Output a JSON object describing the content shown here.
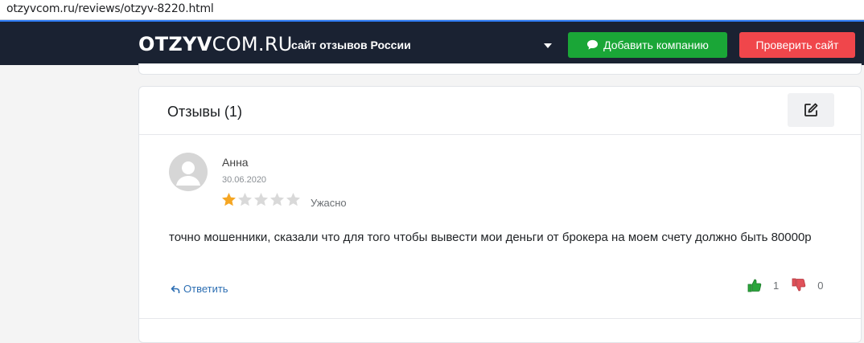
{
  "browser": {
    "url": "otzyvcom.ru/reviews/otzyv-8220.html"
  },
  "header": {
    "logo_bold": "OTZYV",
    "logo_light": "COM.RU",
    "tagline": "сайт отзывов России",
    "add_company_label": "Добавить компанию",
    "check_site_label": "Проверить сайт",
    "colors": {
      "background": "#1a2232",
      "add_button": "#1aa637",
      "check_button": "#f0464b"
    }
  },
  "reviews": {
    "title": "Отзывы (1)",
    "items": [
      {
        "author": "Анна",
        "date": "30.06.2020",
        "rating": 1,
        "rating_max": 5,
        "rating_label": "Ужасно",
        "text": "точно мошенники, сказали что для того чтобы вывести мои деньги от брокера на моем счету должно быть 80000р",
        "reply_label": "Ответить",
        "likes": "1",
        "dislikes": "0"
      }
    ]
  }
}
